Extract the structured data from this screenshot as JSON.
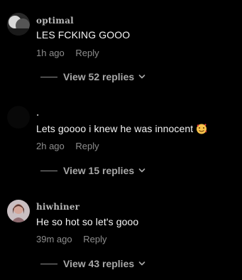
{
  "comments": [
    {
      "username": "optimal",
      "text": "LES FCKING GOOO",
      "time": "1h ago",
      "reply_label": "Reply",
      "view_replies": "View 52 replies",
      "avatar": "avatar-photo-icon"
    },
    {
      "username": ".",
      "text": "Lets goooo i knew he was innocent",
      "emoji": "face-with-heart-eyes-smiling-icon",
      "time": "2h ago",
      "reply_label": "Reply",
      "view_replies": "View 15 replies",
      "avatar": "avatar-blank-icon"
    },
    {
      "username": "hiwhiner",
      "text": "He so hot so let's gooo",
      "time": "39m ago",
      "reply_label": "Reply",
      "view_replies": "View 43 replies",
      "avatar": "avatar-photo-icon"
    }
  ],
  "colors": {
    "background": "#000000",
    "text_primary": "#f5f5f5",
    "text_secondary": "#8e8e8e",
    "view_replies": "#a8a8a8"
  }
}
